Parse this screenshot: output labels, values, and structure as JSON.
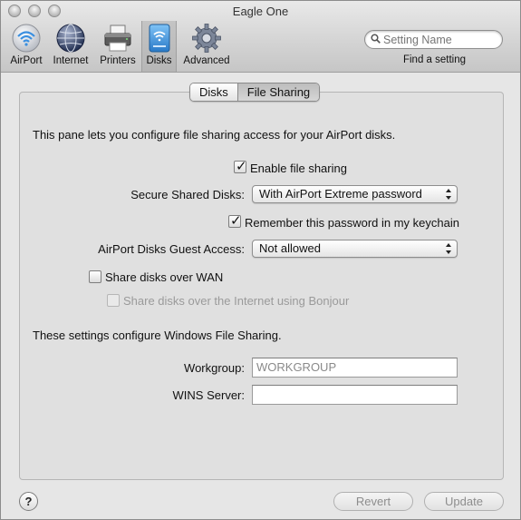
{
  "window": {
    "title": "Eagle One"
  },
  "toolbar": {
    "items": [
      {
        "label": "AirPort",
        "icon": "airport-icon"
      },
      {
        "label": "Internet",
        "icon": "globe-icon"
      },
      {
        "label": "Printers",
        "icon": "printer-icon"
      },
      {
        "label": "Disks",
        "icon": "disk-icon",
        "selected": true
      },
      {
        "label": "Advanced",
        "icon": "gear-icon"
      }
    ],
    "search_placeholder": "Setting Name",
    "find_label": "Find a setting"
  },
  "tabs": [
    {
      "label": "Disks",
      "active": false
    },
    {
      "label": "File Sharing",
      "active": true
    }
  ],
  "pane": {
    "intro": "This pane lets you configure file sharing access for your AirPort disks.",
    "enable_file_sharing": {
      "label": "Enable file sharing",
      "checked": true
    },
    "secure_shared_disks": {
      "label": "Secure Shared Disks:",
      "value": "With AirPort Extreme password"
    },
    "remember_password": {
      "label": "Remember this password in my keychain",
      "checked": true
    },
    "guest_access": {
      "label": "AirPort Disks Guest Access:",
      "value": "Not allowed"
    },
    "share_wan": {
      "label": "Share disks over WAN",
      "checked": false
    },
    "share_bonjour": {
      "label": "Share disks over the Internet using Bonjour",
      "checked": false,
      "enabled": false
    },
    "windows_note": "These settings configure Windows File Sharing.",
    "workgroup": {
      "label": "Workgroup:",
      "value": "WORKGROUP"
    },
    "wins_server": {
      "label": "WINS Server:",
      "value": ""
    }
  },
  "buttons": {
    "help": "?",
    "revert": "Revert",
    "update": "Update"
  },
  "colors": {
    "window_bg": "#e6e6e6",
    "toolbar_bg": "#d3d3d3",
    "disabled_text": "#9a9a9a"
  }
}
